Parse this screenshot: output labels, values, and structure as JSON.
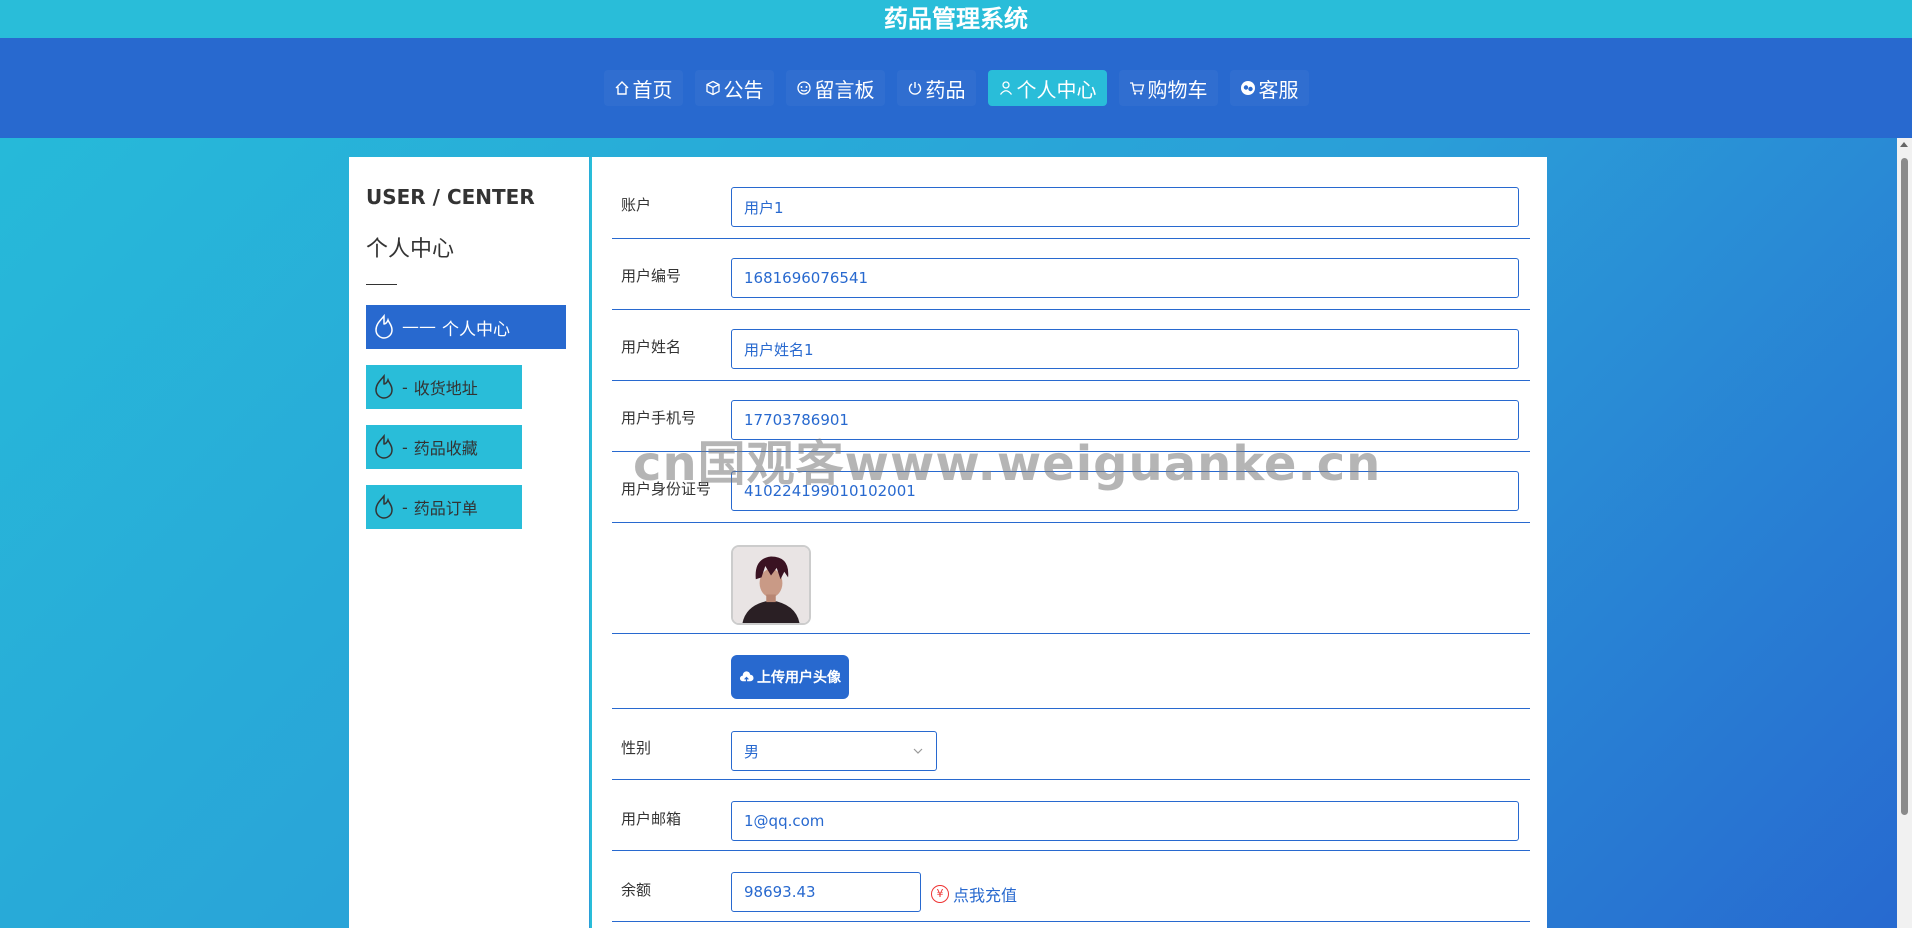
{
  "app_title": "药品管理系统",
  "nav": [
    {
      "label": "首页",
      "icon": "home-icon"
    },
    {
      "label": "公告",
      "icon": "cube-icon"
    },
    {
      "label": "留言板",
      "icon": "message-icon"
    },
    {
      "label": "药品",
      "icon": "power-icon"
    },
    {
      "label": "个人中心",
      "icon": "user-icon",
      "active": true
    },
    {
      "label": "购物车",
      "icon": "cart-icon"
    },
    {
      "label": "客服",
      "icon": "service-icon"
    }
  ],
  "sidebar": {
    "title_en": "USER / CENTER",
    "title_zh": "个人中心",
    "items": [
      {
        "label": "个人中心",
        "prefix": "—— ",
        "active": true
      },
      {
        "label": "收货地址",
        "prefix": "- "
      },
      {
        "label": "药品收藏",
        "prefix": "- "
      },
      {
        "label": "药品订单",
        "prefix": "- "
      }
    ]
  },
  "form": {
    "account": {
      "label": "账户",
      "value": "用户1"
    },
    "user_no": {
      "label": "用户编号",
      "value": "1681696076541"
    },
    "user_name": {
      "label": "用户姓名",
      "value": "用户姓名1"
    },
    "phone": {
      "label": "用户手机号",
      "value": "17703786901"
    },
    "id_card": {
      "label": "用户身份证号",
      "value": "410224199010102001"
    },
    "upload_label": "上传用户头像",
    "gender": {
      "label": "性别",
      "value": "男"
    },
    "email": {
      "label": "用户邮箱",
      "value": "1@qq.com"
    },
    "balance": {
      "label": "余额",
      "value": "98693.43"
    },
    "recharge_label": "点我充值",
    "recharge_symbol": "¥"
  },
  "watermark": "cn国观客www.weiguanke.cn",
  "colors": {
    "primary": "#2869cf",
    "accent": "#29bdd9",
    "recharge_red": "#e33"
  }
}
